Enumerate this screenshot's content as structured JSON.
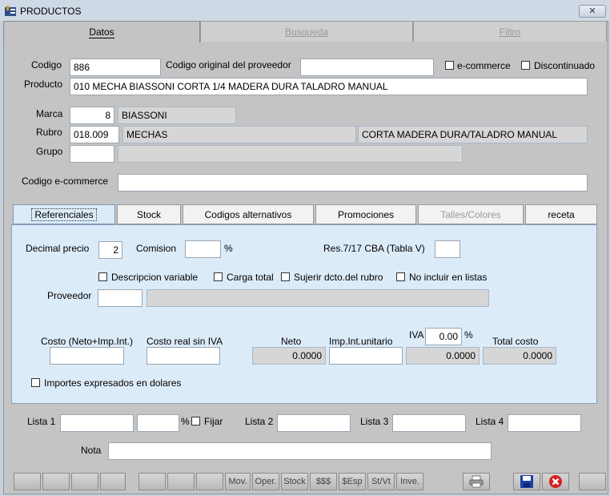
{
  "window": {
    "title": "PRODUCTOS",
    "close": "✕"
  },
  "tabs": [
    "Datos",
    "Busqueda",
    "Filtro"
  ],
  "form": {
    "codigo_label": "Codigo",
    "codigo": "886",
    "codigo_prov_label": "Codigo original del proveedor",
    "codigo_prov": "",
    "ecommerce_label": "e-commerce",
    "discontinuado_label": "Discontinuado",
    "producto_label": "Producto",
    "producto": "010 MECHA BIASSONI CORTA  1/4  MADERA DURA TALADRO MANUAL",
    "marca_label": "Marca",
    "marca_code": "8",
    "marca_name": "BIASSONI",
    "rubro_label": "Rubro",
    "rubro_code": "018.009",
    "rubro_name": "MECHAS",
    "rubro_desc": "CORTA MADERA DURA/TALADRO MANUAL",
    "grupo_label": "Grupo",
    "grupo_code": "",
    "grupo_name": "",
    "codigo_ecommerce_label": "Codigo e-commerce",
    "codigo_ecommerce": ""
  },
  "subtabs": [
    "Referenciales",
    "Stock",
    "Codigos alternativos",
    "Promociones",
    "Talles/Colores",
    "receta"
  ],
  "panel": {
    "decimal_precio_label": "Decimal precio",
    "decimal_precio": "2",
    "comision_label": "Comision",
    "comision": "",
    "percent": "%",
    "res_label": "Res.7/17 CBA (Tabla V)",
    "res": "",
    "descripcion_variable": "Descripcion variable",
    "carga_total": "Carga total",
    "sujerir": "Sujerir dcto.del rubro",
    "no_incluir": "No incluir en listas",
    "proveedor_label": "Proveedor",
    "proveedor_code": "",
    "proveedor_name": "",
    "costo_label": "Costo (Neto+Imp.Int.)",
    "costo": "",
    "costo_real_label": "Costo real sin IVA",
    "costo_real": "",
    "neto_label": "Neto",
    "neto": "0.0000",
    "imp_label": "Imp.Int.unitario",
    "imp": "",
    "iva_label": "IVA",
    "iva": "0.00",
    "iva_amount": "0.0000",
    "total_label": "Total costo",
    "total": "0.0000",
    "dolares_label": "Importes expresados en dolares"
  },
  "listas": {
    "lista1_label": "Lista 1",
    "lista1": "",
    "pct": "",
    "percent": "%",
    "fijar_label": "Fijar",
    "lista2_label": "Lista 2",
    "lista2": "",
    "lista3_label": "Lista 3",
    "lista3": "",
    "lista4_label": "Lista 4",
    "lista4": ""
  },
  "nota_label": "Nota",
  "nota": "",
  "bottom_buttons": [
    "Mov.",
    "Oper.",
    "Stock",
    "$$$",
    "$Esp",
    "St/Vt",
    "Inve."
  ],
  "colors": {
    "panel": "#dcebf8",
    "window": "#c4c4c4",
    "save": "#1b3fa8",
    "delete": "#d42020"
  }
}
